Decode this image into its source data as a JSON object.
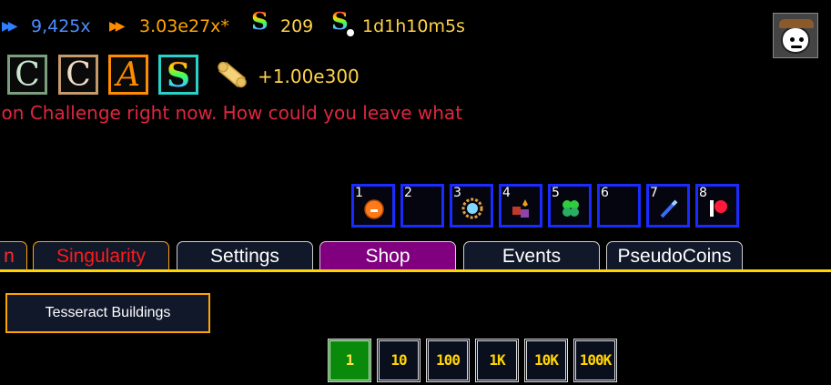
{
  "stats": {
    "ascend_mult": "9,425x",
    "speed_mult": "3.03e27x*",
    "singularity_count": "209",
    "singularity_time": "1d1h10m5s"
  },
  "challenges": {
    "icons": [
      "C",
      "C",
      "A",
      "S"
    ],
    "ticket_value": "+1.00e300"
  },
  "challenge_message": "ion Challenge right now. How could you leave what",
  "rune_slots": [
    {
      "num": "1",
      "icon": "orange-blob-icon"
    },
    {
      "num": "2",
      "icon": ""
    },
    {
      "num": "3",
      "icon": "sun-gear-icon"
    },
    {
      "num": "4",
      "icon": "cubes-icon"
    },
    {
      "num": "5",
      "icon": "clover-icon"
    },
    {
      "num": "6",
      "icon": ""
    },
    {
      "num": "7",
      "icon": "wand-icon"
    },
    {
      "num": "8",
      "icon": "patreon-icon"
    }
  ],
  "tabs": {
    "cut": "n",
    "singularity": "Singularity",
    "settings": "Settings",
    "shop": "Shop",
    "events": "Events",
    "pseudocoins": "PseudoCoins"
  },
  "subtab": {
    "tesseract": "Tesseract Buildings"
  },
  "buy_amounts": [
    "1",
    "10",
    "100",
    "1K",
    "10K",
    "100K"
  ],
  "colors": {
    "shop_tab": "#800080",
    "tab_underline": "#ffd400",
    "slot_border": "#1a2bff"
  }
}
